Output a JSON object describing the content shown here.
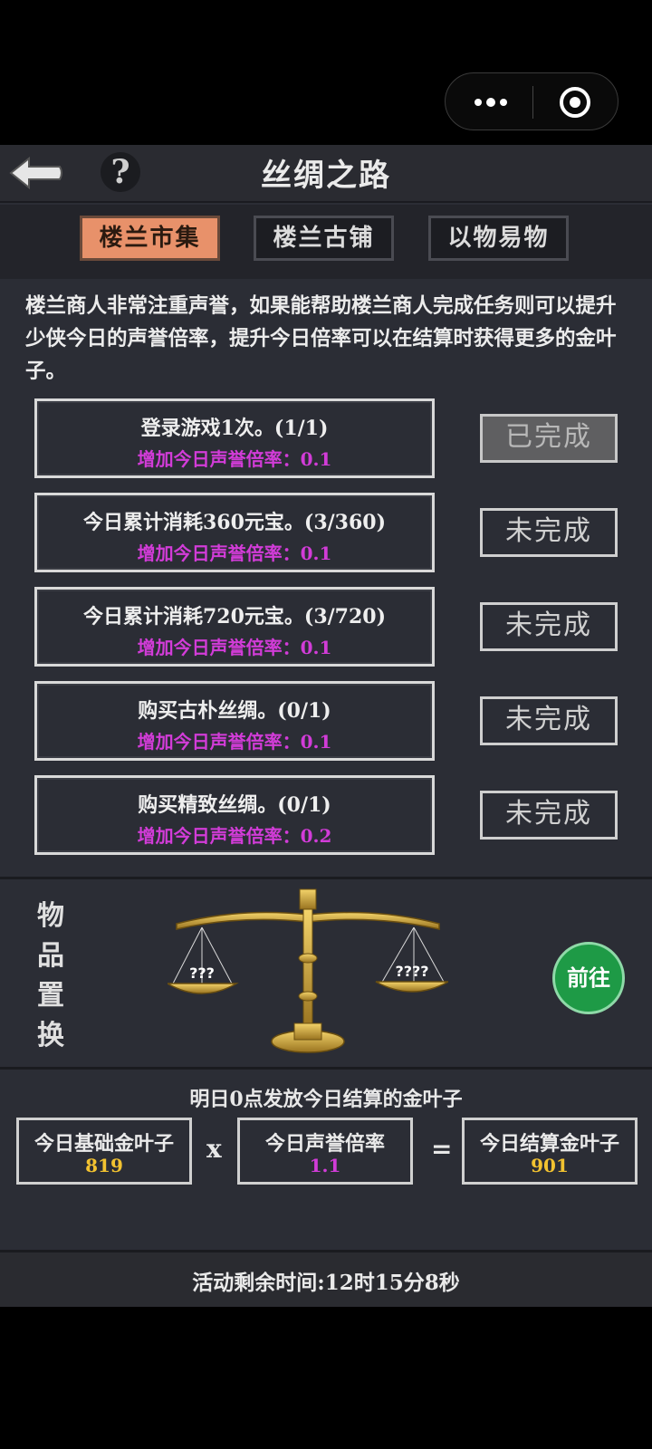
{
  "title": "丝绸之路",
  "tabs": [
    {
      "label": "楼兰市集",
      "active": true
    },
    {
      "label": "楼兰古铺",
      "active": false
    },
    {
      "label": "以物易物",
      "active": false
    }
  ],
  "description": "楼兰商人非常注重声誉，如果能帮助楼兰商人完成任务则可以提升少侠今日的声誉倍率，提升今日倍率可以在结算时获得更多的金叶子。",
  "tasks": [
    {
      "name": "登录游戏1次。(1/1)",
      "bonus": "增加今日声誉倍率：0.1",
      "status": "已完成",
      "done": true
    },
    {
      "name": "今日累计消耗360元宝。(3/360)",
      "bonus": "增加今日声誉倍率：0.1",
      "status": "未完成",
      "done": false
    },
    {
      "name": "今日累计消耗720元宝。(3/720)",
      "bonus": "增加今日声誉倍率：0.1",
      "status": "未完成",
      "done": false
    },
    {
      "name": "购买古朴丝绸。(0/1)",
      "bonus": "增加今日声誉倍率：0.1",
      "status": "未完成",
      "done": false
    },
    {
      "name": "购买精致丝绸。(0/1)",
      "bonus": "增加今日声誉倍率：0.2",
      "status": "未完成",
      "done": false
    }
  ],
  "exchange": {
    "label": "物品置换",
    "left_pan": "???",
    "right_pan": "????",
    "go_button": "前往"
  },
  "settlement": {
    "note": "明日0点发放今日结算的金叶子",
    "base_label": "今日基础金叶子",
    "base_value": "819",
    "times": "x",
    "rate_label": "今日声誉倍率",
    "rate_value": "1.1",
    "equals": "=",
    "result_label": "今日结算金叶子",
    "result_value": "901"
  },
  "timer": "活动剩余时间:12时15分8秒",
  "colors": {
    "bonus": "#d23cd8",
    "gold": "#f2c230",
    "rate": "#d23cd8",
    "tab_active": "#e8916a",
    "go_button": "#1e9a46"
  }
}
